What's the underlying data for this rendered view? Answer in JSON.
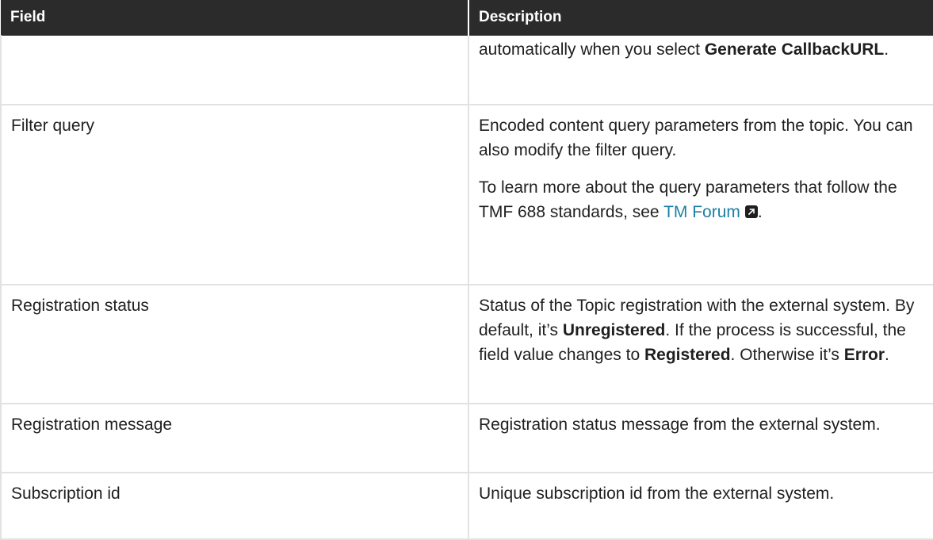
{
  "table": {
    "headers": [
      "Field",
      "Description"
    ],
    "rows": [
      {
        "field": "",
        "description": {
          "p1": {
            "t1": "automatically when you select ",
            "b1": "Generate CallbackURL",
            "t2": "."
          }
        }
      },
      {
        "field": "Filter query",
        "description": {
          "p1": {
            "t1": "Encoded content query parameters from the topic. You can also modify the filter query."
          },
          "p2": {
            "t1": "To learn more about the query parameters that follow the TMF 688 standards, see ",
            "link": "TM Forum",
            "link_icon": "external-link-icon",
            "t2": "."
          }
        }
      },
      {
        "field": "Registration status",
        "description": {
          "p1": {
            "t1": "Status of the Topic registration with the external system. By default, it’s ",
            "b1": "Unregistered",
            "t2": ". If the process is successful, the field value changes to ",
            "b2": "Registered",
            "t3": ". Otherwise it’s ",
            "b3": "Error",
            "t4": "."
          }
        }
      },
      {
        "field": "Registration message",
        "description": {
          "p1": {
            "t1": "Registration status message from the external system."
          }
        }
      },
      {
        "field": "Subscription id",
        "description": {
          "p1": {
            "t1": "Unique subscription id from the external system."
          }
        }
      }
    ]
  },
  "colors": {
    "header_bg": "#2b2b2b",
    "link": "#1c7fa3",
    "border": "#e2e2e2"
  }
}
